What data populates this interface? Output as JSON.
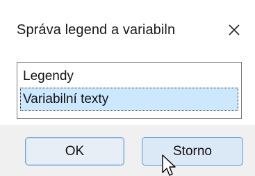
{
  "dialog": {
    "title": "Správa legend a variabiln",
    "close_icon": "close-icon"
  },
  "list": {
    "items": [
      {
        "label": "Legendy",
        "selected": false
      },
      {
        "label": "Variabilní texty",
        "selected": true
      }
    ]
  },
  "buttons": {
    "ok_label": "OK",
    "cancel_label": "Storno"
  },
  "colors": {
    "selection": "#cce8ff",
    "footer": "#f0f0f0",
    "button_focus": "#5e9bd6"
  },
  "cursor_icon": "mouse-pointer-icon"
}
